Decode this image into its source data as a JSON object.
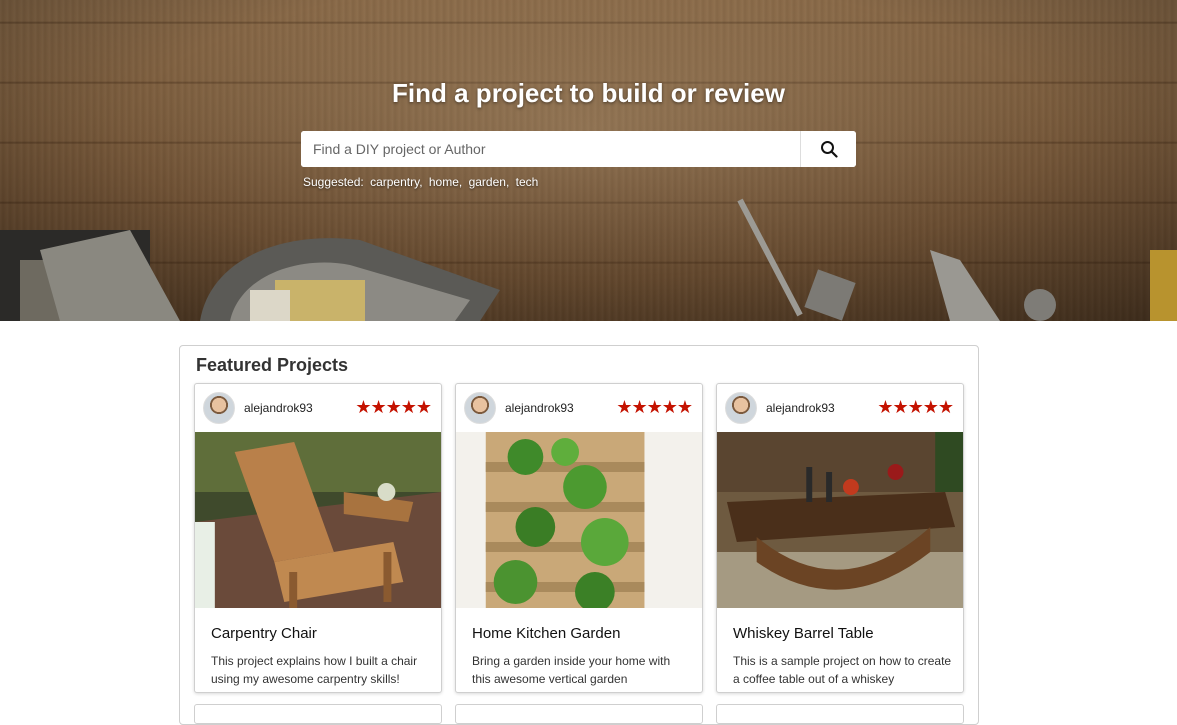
{
  "hero": {
    "title": "Find a project to build or review",
    "search": {
      "placeholder": "Find a DIY project or Author",
      "value": ""
    },
    "suggested_label": "Suggested:",
    "suggested": [
      "carpentry",
      "home",
      "garden",
      "tech"
    ]
  },
  "featured": {
    "heading": "Featured Projects",
    "cards": [
      {
        "author": "alejandrok93",
        "rating": 5,
        "stars": "★★★★★",
        "title": "Carpentry Chair",
        "description": "This project explains how I built a chair using my awesome carpentry skills!"
      },
      {
        "author": "alejandrok93",
        "rating": 5,
        "stars": "★★★★★",
        "title": "Home Kitchen Garden",
        "description": "Bring a garden inside your home with this awesome vertical garden"
      },
      {
        "author": "alejandrok93",
        "rating": 5,
        "stars": "★★★★★",
        "title": "Whiskey Barrel Table",
        "description": "This is a sample project on how to create a coffee table out of a whiskey"
      }
    ]
  },
  "colors": {
    "star": "#c41200",
    "heading": "#333333"
  }
}
